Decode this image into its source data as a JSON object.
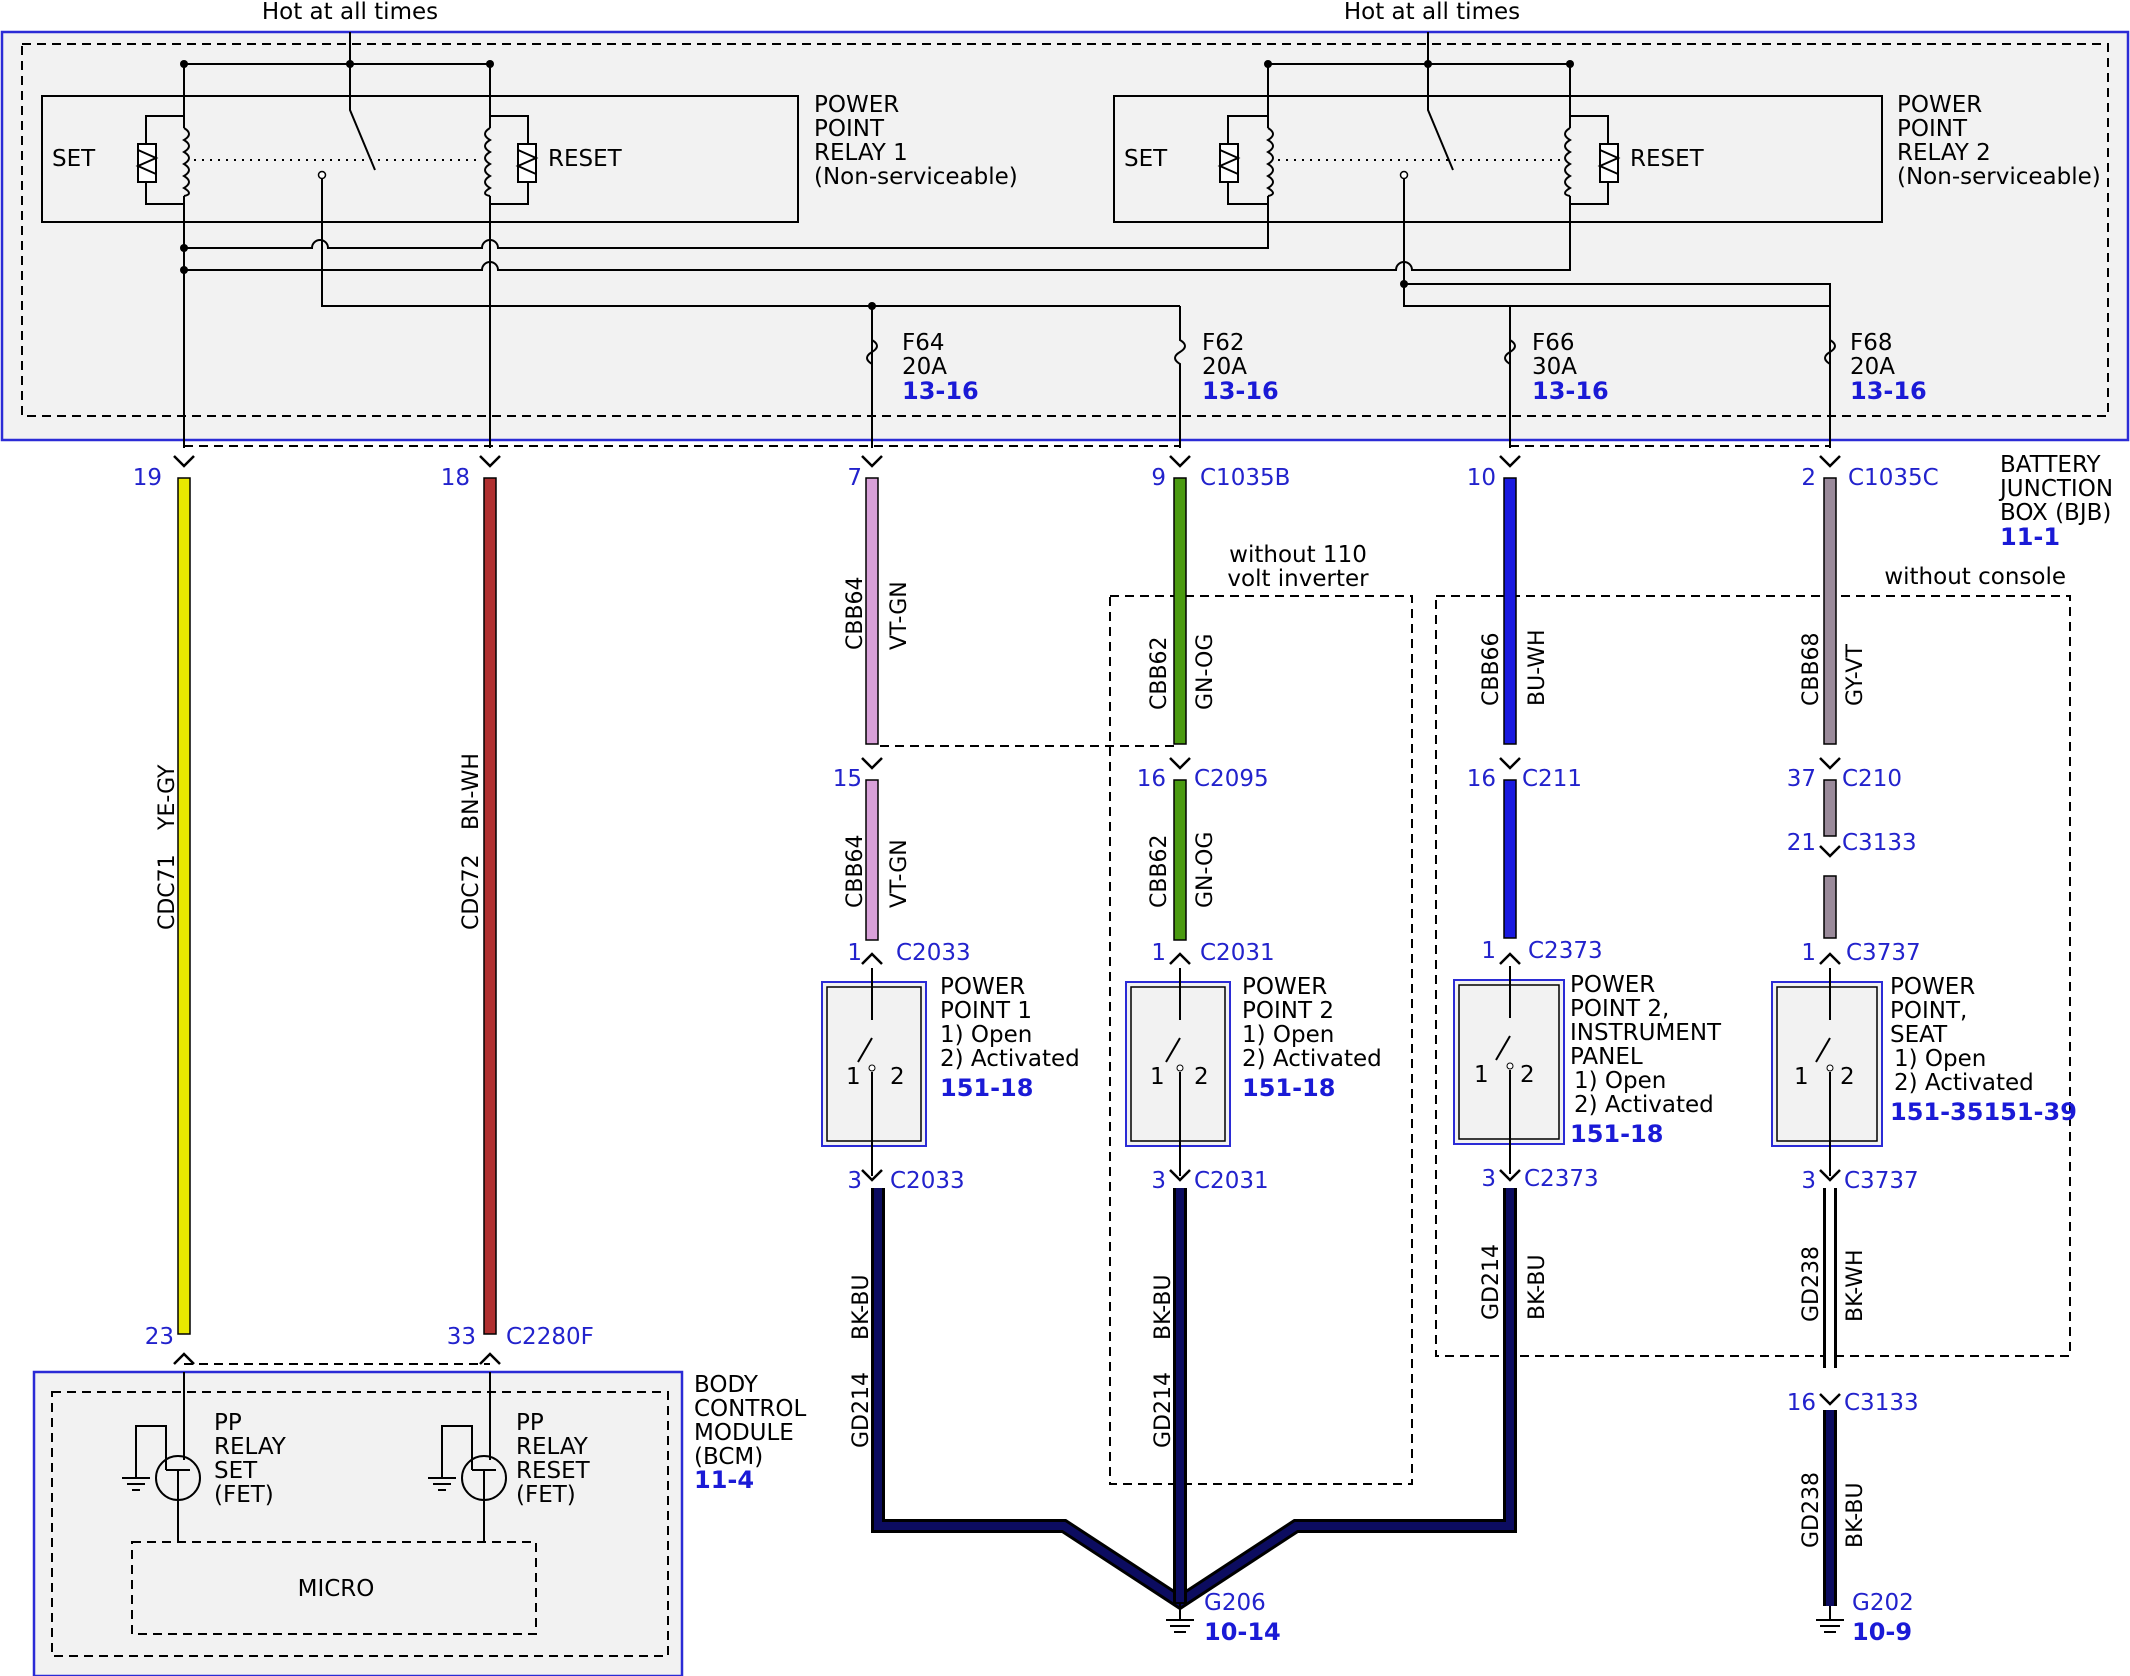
{
  "bjb": {
    "hot_left": "Hot at all times",
    "hot_right": "Hot at all times",
    "name_lines": [
      "BATTERY",
      "JUNCTION",
      "BOX (BJB)"
    ],
    "ref": "11-1"
  },
  "relay1": {
    "set": "SET",
    "reset": "RESET",
    "name_lines": [
      "POWER",
      "POINT",
      "RELAY 1",
      "(Non-serviceable)"
    ]
  },
  "relay2": {
    "set": "SET",
    "reset": "RESET",
    "name_lines": [
      "POWER",
      "POINT",
      "RELAY 2",
      "(Non-serviceable)"
    ]
  },
  "fuses": [
    {
      "name": "F64",
      "rating": "20A",
      "ref": "13-16"
    },
    {
      "name": "F62",
      "rating": "20A",
      "ref": "13-16"
    },
    {
      "name": "F66",
      "rating": "30A",
      "ref": "13-16"
    },
    {
      "name": "F68",
      "rating": "20A",
      "ref": "13-16"
    }
  ],
  "connectors": {
    "c1035b": "C1035B",
    "c1035c": "C1035C",
    "c2095": "C2095",
    "c211": "C211",
    "c210": "C210",
    "c3133": "C3133",
    "c2033": "C2033",
    "c2031": "C2031",
    "c2373": "C2373",
    "c3737": "C3737",
    "c2280f": "C2280F"
  },
  "pins": {
    "p19": "19",
    "p18": "18",
    "p7": "7",
    "p9": "9",
    "p10": "10",
    "p2": "2",
    "p15": "15",
    "p16a": "16",
    "p16b": "16",
    "p37": "37",
    "p21": "21",
    "p1a": "1",
    "p1b": "1",
    "p1c": "1",
    "p1d": "1",
    "p3a": "3",
    "p3b": "3",
    "p3c": "3",
    "p3d": "3",
    "p23": "23",
    "p33": "33",
    "p16c": "16"
  },
  "wires": {
    "cdc71": {
      "circuit": "CDC71",
      "color": "YE-GY"
    },
    "cdc72": {
      "circuit": "CDC72",
      "color": "BN-WH"
    },
    "cbb64a": {
      "circuit": "CBB64",
      "color": "VT-GN"
    },
    "cbb64b": {
      "circuit": "CBB64",
      "color": "VT-GN"
    },
    "cbb62a": {
      "circuit": "CBB62",
      "color": "GN-OG"
    },
    "cbb62b": {
      "circuit": "CBB62",
      "color": "GN-OG"
    },
    "cbb66": {
      "circuit": "CBB66",
      "color": "BU-WH"
    },
    "cbb68": {
      "circuit": "CBB68",
      "color": "GY-VT"
    },
    "gd214a": {
      "circuit": "GD214",
      "color": "BK-BU"
    },
    "gd214b": {
      "circuit": "GD214",
      "color": "BK-BU"
    },
    "gd214c": {
      "circuit": "GD214",
      "color": "BK-BU"
    },
    "gd238a": {
      "circuit": "GD238",
      "color": "BK-WH"
    },
    "gd238b": {
      "circuit": "GD238",
      "color": "BK-BU"
    }
  },
  "options": {
    "inverter_lines": [
      "without 110",
      "volt inverter"
    ],
    "console": "without console"
  },
  "power_points": [
    {
      "lines": [
        "POWER",
        "POINT 1",
        "1) Open",
        "2) Activated"
      ],
      "ref": "151-18"
    },
    {
      "lines": [
        "POWER",
        "POINT 2",
        "1) Open",
        "2) Activated"
      ],
      "ref": "151-18"
    },
    {
      "lines": [
        "POWER",
        "POINT 2,",
        "INSTRUMENT",
        "PANEL",
        "1) Open",
        "2) Activated"
      ],
      "ref": "151-18"
    },
    {
      "lines": [
        "POWER",
        "POINT,",
        "SEAT",
        "1) Open",
        "2) Activated"
      ],
      "ref": "151-35151-39"
    }
  ],
  "switch_pins": {
    "one": "1",
    "two": "2"
  },
  "bcm": {
    "name_lines": [
      "BODY",
      "CONTROL",
      "MODULE",
      "(BCM)"
    ],
    "ref": "11-4",
    "fet_set_lines": [
      "PP",
      "RELAY",
      "SET",
      "(FET)"
    ],
    "fet_reset_lines": [
      "PP",
      "RELAY",
      "RESET",
      "(FET)"
    ],
    "micro": "MICRO"
  },
  "grounds": {
    "g206": "G206",
    "g206_ref": "10-14",
    "g202": "G202",
    "g202_ref": "10-9"
  },
  "colors": {
    "ye_gy": "#e8e800",
    "bn_wh": "#b03030",
    "vt_gn": "#d8a0d8",
    "gn_og": "#4a9a10",
    "bu_wh": "#1a1ae0",
    "gy_vt": "#9a8a9a",
    "bk_bu": "#0c0c60",
    "bk_wh": "#222222",
    "link_blue": "#1a1ad6",
    "border_blue": "#2b2bd6"
  }
}
